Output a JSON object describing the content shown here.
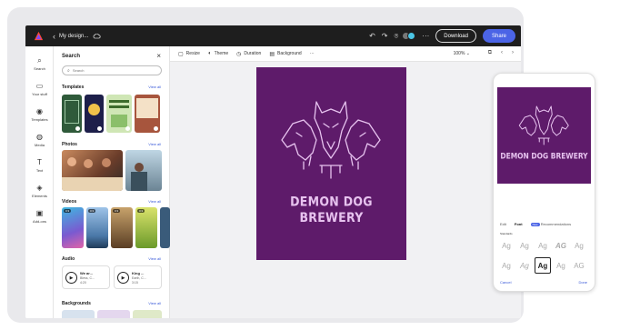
{
  "topbar": {
    "back_glyph": "‹",
    "title": "My design...",
    "cloud_icon": "cloud-icon",
    "undo": "↶",
    "redo": "↷",
    "pin": "⌾",
    "more": "···",
    "download_label": "Download",
    "share_label": "Share",
    "accent": "#4b64e6"
  },
  "rail": {
    "items": [
      {
        "glyph": "⌕",
        "label": "Search"
      },
      {
        "glyph": "▭",
        "label": "Your stuff"
      },
      {
        "glyph": "◉",
        "label": "Templates"
      },
      {
        "glyph": "◍",
        "label": "Media"
      },
      {
        "glyph": "T",
        "label": "Text"
      },
      {
        "glyph": "◈",
        "label": "Elements"
      },
      {
        "glyph": "▣",
        "label": "Add-ons"
      }
    ]
  },
  "panel": {
    "title": "Search",
    "close": "×",
    "search_placeholder": "Search",
    "templates_title": "Templates",
    "photos_title": "Photos",
    "videos_title": "Videos",
    "audio_title": "Audio",
    "backgrounds_title": "Backgrounds",
    "view_all": "View all",
    "video_badges": [
      "0:3",
      "0:3",
      "0:3",
      "0:3"
    ],
    "audio": [
      {
        "title": "We ar...",
        "sub1": "Bless, C...",
        "sub2": "4:20"
      },
      {
        "title": "King ...",
        "sub1": "Earth, C...",
        "sub2": "3:15"
      }
    ]
  },
  "toolbar": {
    "resize": "Resize",
    "theme": "Theme",
    "duration": "Duration",
    "background": "Background",
    "more": "···",
    "zoom": "100%",
    "chev": "⌄"
  },
  "design": {
    "title": "DEMON DOG BREWERY",
    "bg_color": "#5e1b6a",
    "ink_color": "#e7c3ef"
  },
  "phone": {
    "tab_edit": "Edit",
    "tab_font": "Font",
    "tab_new": "New",
    "tab_recommendations": "Recommendations",
    "sub_label": "Standards",
    "fonts_row1": [
      "Ag",
      "Ag",
      "Ag",
      "AG",
      "Ag"
    ],
    "fonts_row2": [
      "Ag",
      "Ag",
      "Ag",
      "Ag",
      "AG"
    ],
    "cancel": "Cancel",
    "done": "Done"
  }
}
